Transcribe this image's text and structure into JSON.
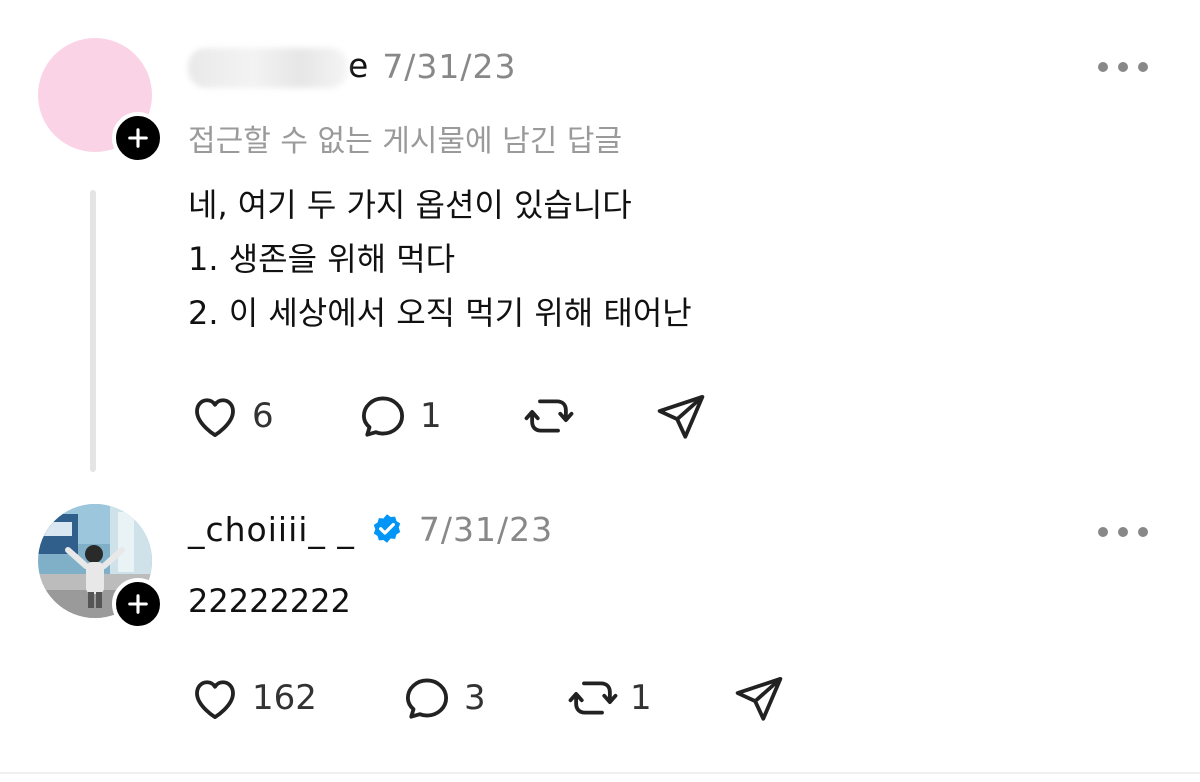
{
  "posts": [
    {
      "username_visible_suffix": "e",
      "date": "7/31/23",
      "subtitle": "접근할 수 없는 게시물에 남긴 답글",
      "lines": [
        "네, 여기 두 가지 옵션이 있습니다",
        "1. 생존을 위해 먹다",
        "2. 이 세상에서 오직 먹기 위해 태어난"
      ],
      "likes": "6",
      "replies": "1",
      "reposts": ""
    },
    {
      "username": "_choiiii_ _",
      "verified": true,
      "date": "7/31/23",
      "text": "22222222",
      "likes": "162",
      "replies": "3",
      "reposts": "1"
    }
  ],
  "icons": {
    "like": "heart-icon",
    "reply": "comment-icon",
    "repost": "repost-icon",
    "share": "send-icon",
    "follow": "plus-icon",
    "more": "more-icon",
    "verified": "verified-badge-icon"
  },
  "colors": {
    "verified_blue": "#0095f6",
    "muted_text": "#888888",
    "avatar_pink": "#fbd3e6"
  }
}
